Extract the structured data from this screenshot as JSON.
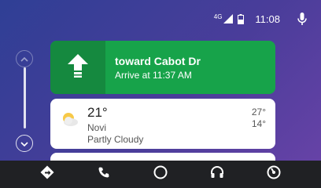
{
  "status_bar": {
    "network": "4G",
    "time": "11:08",
    "icons": [
      "signal-icon",
      "battery-icon",
      "microphone-icon"
    ]
  },
  "navigation_card": {
    "icon": "straight-arrow-icon",
    "road": "toward Cabot Dr",
    "arrive": "Arrive at 11:37 AM",
    "color": "#17a34a"
  },
  "weather_card": {
    "icon": "partly-cloudy-icon",
    "temperature": "21°",
    "city": "Novi",
    "condition": "Partly Cloudy",
    "high": "27°",
    "low": "14°"
  },
  "rail": {
    "icons": [
      "scroll-up-icon",
      "scroll-down-icon"
    ]
  },
  "bottom_nav": {
    "items": [
      "navigation-icon",
      "phone-icon",
      "home-icon",
      "audio-icon",
      "car-menu-icon"
    ]
  }
}
